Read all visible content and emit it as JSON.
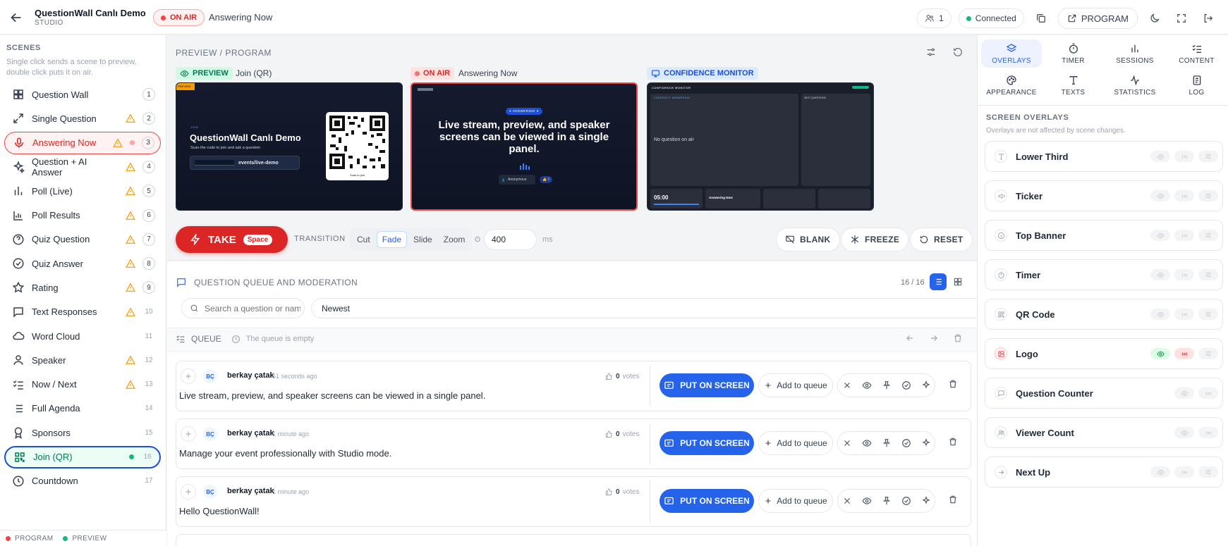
{
  "header": {
    "title": "QuestionWall Canlı Demo",
    "subtitle": "STUDIO",
    "onair": "ON AIR",
    "current_scene": "Answering Now",
    "viewer_count": "1",
    "connection": "Connected",
    "program_label": "PROGRAM"
  },
  "sidebar": {
    "title": "SCENES",
    "help": "Single click sends a scene to preview, double click puts it on air.",
    "scenes": [
      {
        "label": "Question Wall",
        "num": "1",
        "icon": "grid-icon",
        "warn": false,
        "state": ""
      },
      {
        "label": "Single Question",
        "num": "2",
        "icon": "expand-icon",
        "warn": true,
        "state": ""
      },
      {
        "label": "Answering Now",
        "num": "3",
        "icon": "mic-icon",
        "warn": true,
        "state": "live"
      },
      {
        "label": "Question + AI Answer",
        "num": "4",
        "icon": "sparkle-icon",
        "warn": true,
        "state": ""
      },
      {
        "label": "Poll (Live)",
        "num": "5",
        "icon": "bar-chart-icon",
        "warn": true,
        "state": ""
      },
      {
        "label": "Poll Results",
        "num": "6",
        "icon": "chart-icon",
        "warn": true,
        "state": ""
      },
      {
        "label": "Quiz Question",
        "num": "7",
        "icon": "help-circle-icon",
        "warn": true,
        "state": ""
      },
      {
        "label": "Quiz Answer",
        "num": "8",
        "icon": "check-circle-icon",
        "warn": true,
        "state": ""
      },
      {
        "label": "Rating",
        "num": "9",
        "icon": "star-icon",
        "warn": true,
        "state": ""
      },
      {
        "label": "Text Responses",
        "num": "10",
        "icon": "message-icon",
        "warn": true,
        "state": ""
      },
      {
        "label": "Word Cloud",
        "num": "11",
        "icon": "cloud-icon",
        "warn": false,
        "state": ""
      },
      {
        "label": "Speaker",
        "num": "12",
        "icon": "user-icon",
        "warn": true,
        "state": ""
      },
      {
        "label": "Now / Next",
        "num": "13",
        "icon": "list-check-icon",
        "warn": true,
        "state": ""
      },
      {
        "label": "Full Agenda",
        "num": "14",
        "icon": "list-icon",
        "warn": false,
        "state": ""
      },
      {
        "label": "Sponsors",
        "num": "15",
        "icon": "award-icon",
        "warn": false,
        "state": ""
      },
      {
        "label": "Join (QR)",
        "num": "16",
        "icon": "qr-icon",
        "warn": false,
        "state": "prev"
      },
      {
        "label": "Countdown",
        "num": "17",
        "icon": "clock-icon",
        "warn": false,
        "state": ""
      }
    ],
    "footer_program": "PROGRAM",
    "footer_preview": "PREVIEW"
  },
  "preview": {
    "title": "PREVIEW / PROGRAM",
    "preview_badge": "PREVIEW",
    "preview_scene": "Join (QR)",
    "program_badge": "ON AIR",
    "program_scene": "Answering Now",
    "confidence_badge": "CONFIDENCE MONITOR",
    "join_label": "JOIN",
    "join_title": "QuestionWall Canlı Demo",
    "join_sub": "Scan the code to join and ask a question",
    "join_url": "events/live-demo",
    "scan_label": "Scan to join",
    "answering_badge": "● ANSWERING ●",
    "answering_text": "Live stream, preview, and speaker screens can be viewed in a single panel.",
    "answering_author": "Anonymous",
    "conf_header": "CONFIDENCE MONITOR",
    "conf_current": "CURRENTLY ANSWERING",
    "conf_next": "NEXT QUESTIONS",
    "conf_empty": "No question on air",
    "conf_timer": "05:00",
    "conf_scene": "Answering Now"
  },
  "controls": {
    "take": "TAKE",
    "take_key": "Space",
    "transition_label": "TRANSITION",
    "transitions": [
      "Cut",
      "Fade",
      "Slide",
      "Zoom"
    ],
    "active_transition": "Fade",
    "duration": "400",
    "unit": "ms",
    "blank": "BLANK",
    "freeze": "FREEZE",
    "reset": "RESET"
  },
  "queue": {
    "title": "QUESTION QUEUE AND MODERATION",
    "count": "16 / 16",
    "search_placeholder": "Search a question or name",
    "sort": "Newest",
    "queue_label": "QUEUE",
    "queue_empty": "The queue is empty",
    "put_label": "PUT ON SCREEN",
    "add_label": "Add to queue",
    "votes_label": "votes",
    "items": [
      {
        "initials": "BÇ",
        "name": "berkay çatak",
        "time": "51 seconds ago",
        "votes": "0",
        "text": "Live stream, preview, and speaker screens can be viewed in a single panel."
      },
      {
        "initials": "BÇ",
        "name": "berkay çatak",
        "time": "1 minute ago",
        "votes": "0",
        "text": "Manage your event professionally with Studio mode."
      },
      {
        "initials": "BÇ",
        "name": "berkay çatak",
        "time": "1 minute ago",
        "votes": "0",
        "text": "Hello QuestionWall!"
      }
    ]
  },
  "right": {
    "tabs": [
      {
        "label": "OVERLAYS",
        "icon": "layers-icon",
        "on": true
      },
      {
        "label": "TIMER",
        "icon": "stopwatch-icon",
        "on": false
      },
      {
        "label": "SESSIONS",
        "icon": "bar-chart-icon",
        "on": false
      },
      {
        "label": "CONTENT",
        "icon": "list-check-icon",
        "on": false
      },
      {
        "label": "APPEARANCE",
        "icon": "palette-icon",
        "on": false
      },
      {
        "label": "TEXTS",
        "icon": "type-icon",
        "on": false
      },
      {
        "label": "STATISTICS",
        "icon": "activity-icon",
        "on": false
      },
      {
        "label": "LOG",
        "icon": "log-icon",
        "on": false
      }
    ],
    "overlays_title": "SCREEN OVERLAYS",
    "overlays_help": "Overlays are not affected by scene changes.",
    "overlays": [
      {
        "label": "Lower Third",
        "icon": "type-icon",
        "on": false,
        "handle": true
      },
      {
        "label": "Ticker",
        "icon": "megaphone-icon",
        "on": false,
        "handle": true
      },
      {
        "label": "Top Banner",
        "icon": "info-icon",
        "on": false,
        "handle": true
      },
      {
        "label": "Timer",
        "icon": "stopwatch-icon",
        "on": false,
        "handle": true
      },
      {
        "label": "QR Code",
        "icon": "qr-icon",
        "on": false,
        "handle": true
      },
      {
        "label": "Logo",
        "icon": "image-icon",
        "on": true,
        "handle": true
      },
      {
        "label": "Question Counter",
        "icon": "message-icon",
        "on": false,
        "handle": false
      },
      {
        "label": "Viewer Count",
        "icon": "users-icon",
        "on": false,
        "handle": false
      },
      {
        "label": "Next Up",
        "icon": "arrow-right-icon",
        "on": false,
        "handle": true
      }
    ]
  }
}
